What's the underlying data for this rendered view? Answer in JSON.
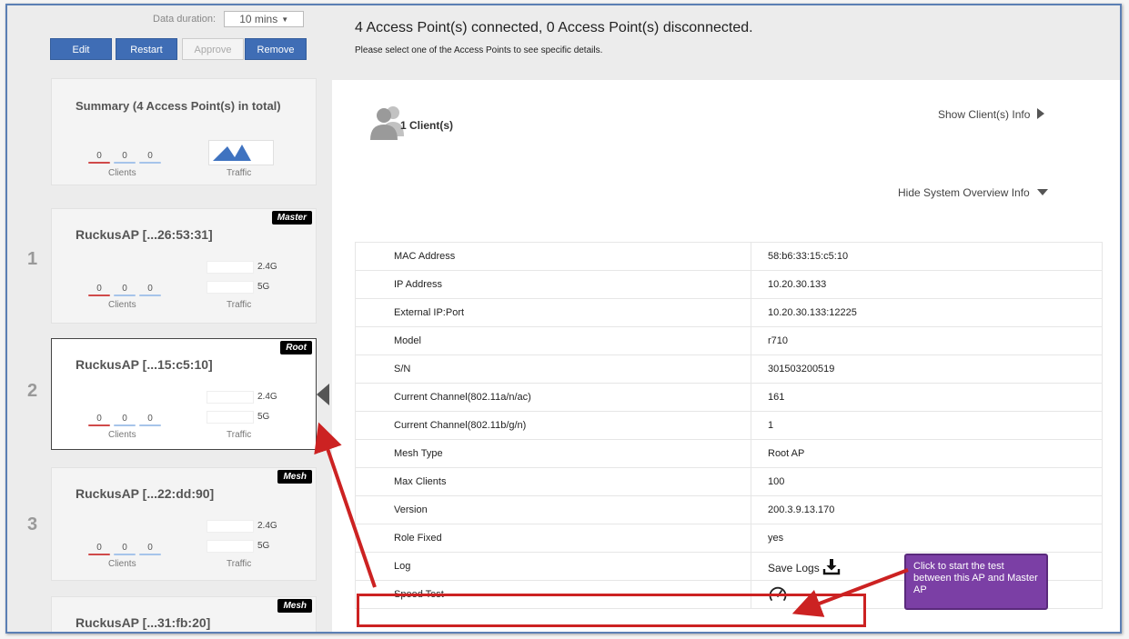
{
  "toolbar": {
    "duration_label": "Data duration:",
    "duration_value": "10 mins",
    "edit_label": "Edit",
    "restart_label": "Restart",
    "approve_label": "Approve",
    "remove_label": "Remove"
  },
  "summary": {
    "title": "Summary (4 Access Point(s) in total)",
    "stats": [
      "0",
      "0",
      "0"
    ],
    "clients_caption": "Clients",
    "traffic_caption": "Traffic"
  },
  "aps": [
    {
      "index": "1",
      "name": "RuckusAP [...26:53:31]",
      "role": "Master",
      "stats": [
        "0",
        "0",
        "0"
      ],
      "band_24": "2.4G",
      "band_5": "5G",
      "clients_caption": "Clients",
      "traffic_caption": "Traffic"
    },
    {
      "index": "2",
      "name": "RuckusAP [...15:c5:10]",
      "role": "Root",
      "stats": [
        "0",
        "0",
        "0"
      ],
      "band_24": "2.4G",
      "band_5": "5G",
      "clients_caption": "Clients",
      "traffic_caption": "Traffic"
    },
    {
      "index": "3",
      "name": "RuckusAP [...22:dd:90]",
      "role": "Mesh",
      "stats": [
        "0",
        "0",
        "0"
      ],
      "band_24": "2.4G",
      "band_5": "5G",
      "clients_caption": "Clients",
      "traffic_caption": "Traffic"
    },
    {
      "name": "RuckusAP [...31:fb:20]",
      "role": "Mesh"
    }
  ],
  "header": {
    "status": "4 Access Point(s) connected, 0 Access Point(s) disconnected.",
    "hint": "Please select one of the Access Points to see specific details."
  },
  "detail": {
    "clients_label": "1 Client(s)",
    "show_clients_link": "Show Client(s) Info",
    "hide_overview_link": "Hide System Overview Info",
    "rows": [
      {
        "label": "MAC Address",
        "value": "58:b6:33:15:c5:10"
      },
      {
        "label": "IP Address",
        "value": "10.20.30.133"
      },
      {
        "label": "External IP:Port",
        "value": "10.20.30.133:12225"
      },
      {
        "label": "Model",
        "value": "r710"
      },
      {
        "label": "S/N",
        "value": "301503200519"
      },
      {
        "label": "Current Channel(802.11a/n/ac)",
        "value": "161"
      },
      {
        "label": "Current Channel(802.11b/g/n)",
        "value": "1"
      },
      {
        "label": "Mesh Type",
        "value": "Root AP"
      },
      {
        "label": "Max Clients",
        "value": "100"
      },
      {
        "label": "Version",
        "value": "200.3.9.13.170"
      },
      {
        "label": "Role Fixed",
        "value": "yes"
      },
      {
        "label": "Log",
        "value": "Save Logs"
      },
      {
        "label": "Speed Test",
        "value": ""
      }
    ]
  },
  "callout": {
    "text": "Click to start the test between this AP and Master AP"
  },
  "colors": {
    "button_blue": "#3f6db5",
    "annotation_red": "#cc2222",
    "callout_purple": "#7b3fa5"
  }
}
